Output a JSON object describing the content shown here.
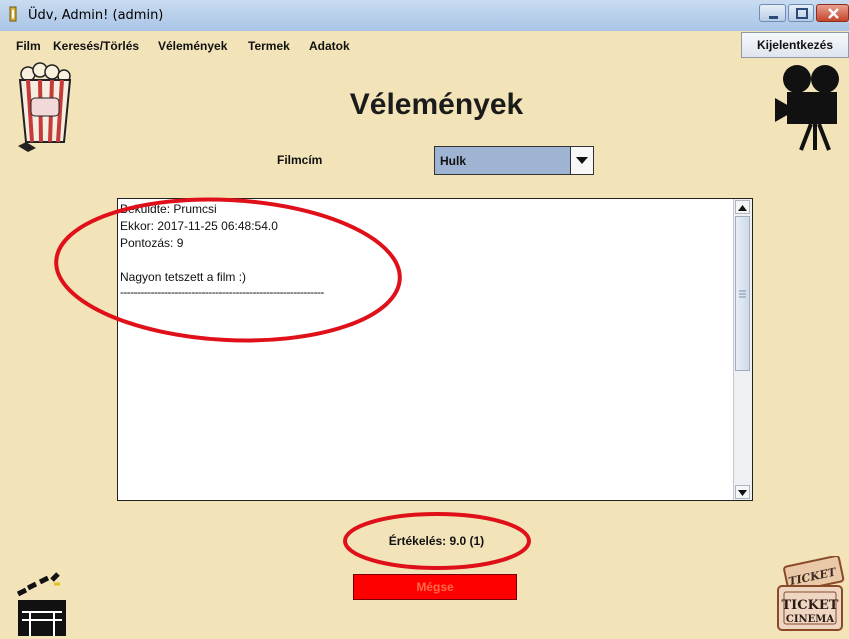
{
  "window": {
    "title": "Üdv, Admin! (admin)"
  },
  "menu": {
    "items": [
      "Film",
      "Keresés/Törlés",
      "Vélemények",
      "Termek",
      "Adatok"
    ],
    "logout_label": "Kijelentkezés"
  },
  "page": {
    "title": "Vélemények",
    "film_label": "Filmcím",
    "film_selected": "Hulk",
    "review_lines": [
      "Beküldte: Prumcsi",
      "Ekkor: 2017-11-25 06:48:54.0",
      "Pontozás: 9",
      "",
      "Nagyon tetszett a film :)",
      "------------------------------------------------------------"
    ],
    "rating_text": "Értékelés: 9.0 (1)",
    "cancel_label": "Mégse"
  },
  "colors": {
    "background": "#f2e4b8",
    "annotation_red": "#e0101a",
    "cancel_bg": "#ff0000",
    "combo_bg": "#9fb3d2"
  },
  "icons": [
    "popcorn-icon",
    "movie-camera-icon",
    "clapperboard-icon",
    "ticket-icon"
  ],
  "decor_text": {
    "ticket_top": "TICKET",
    "ticket_main": "TICKET",
    "ticket_sub": "CINEMA"
  }
}
